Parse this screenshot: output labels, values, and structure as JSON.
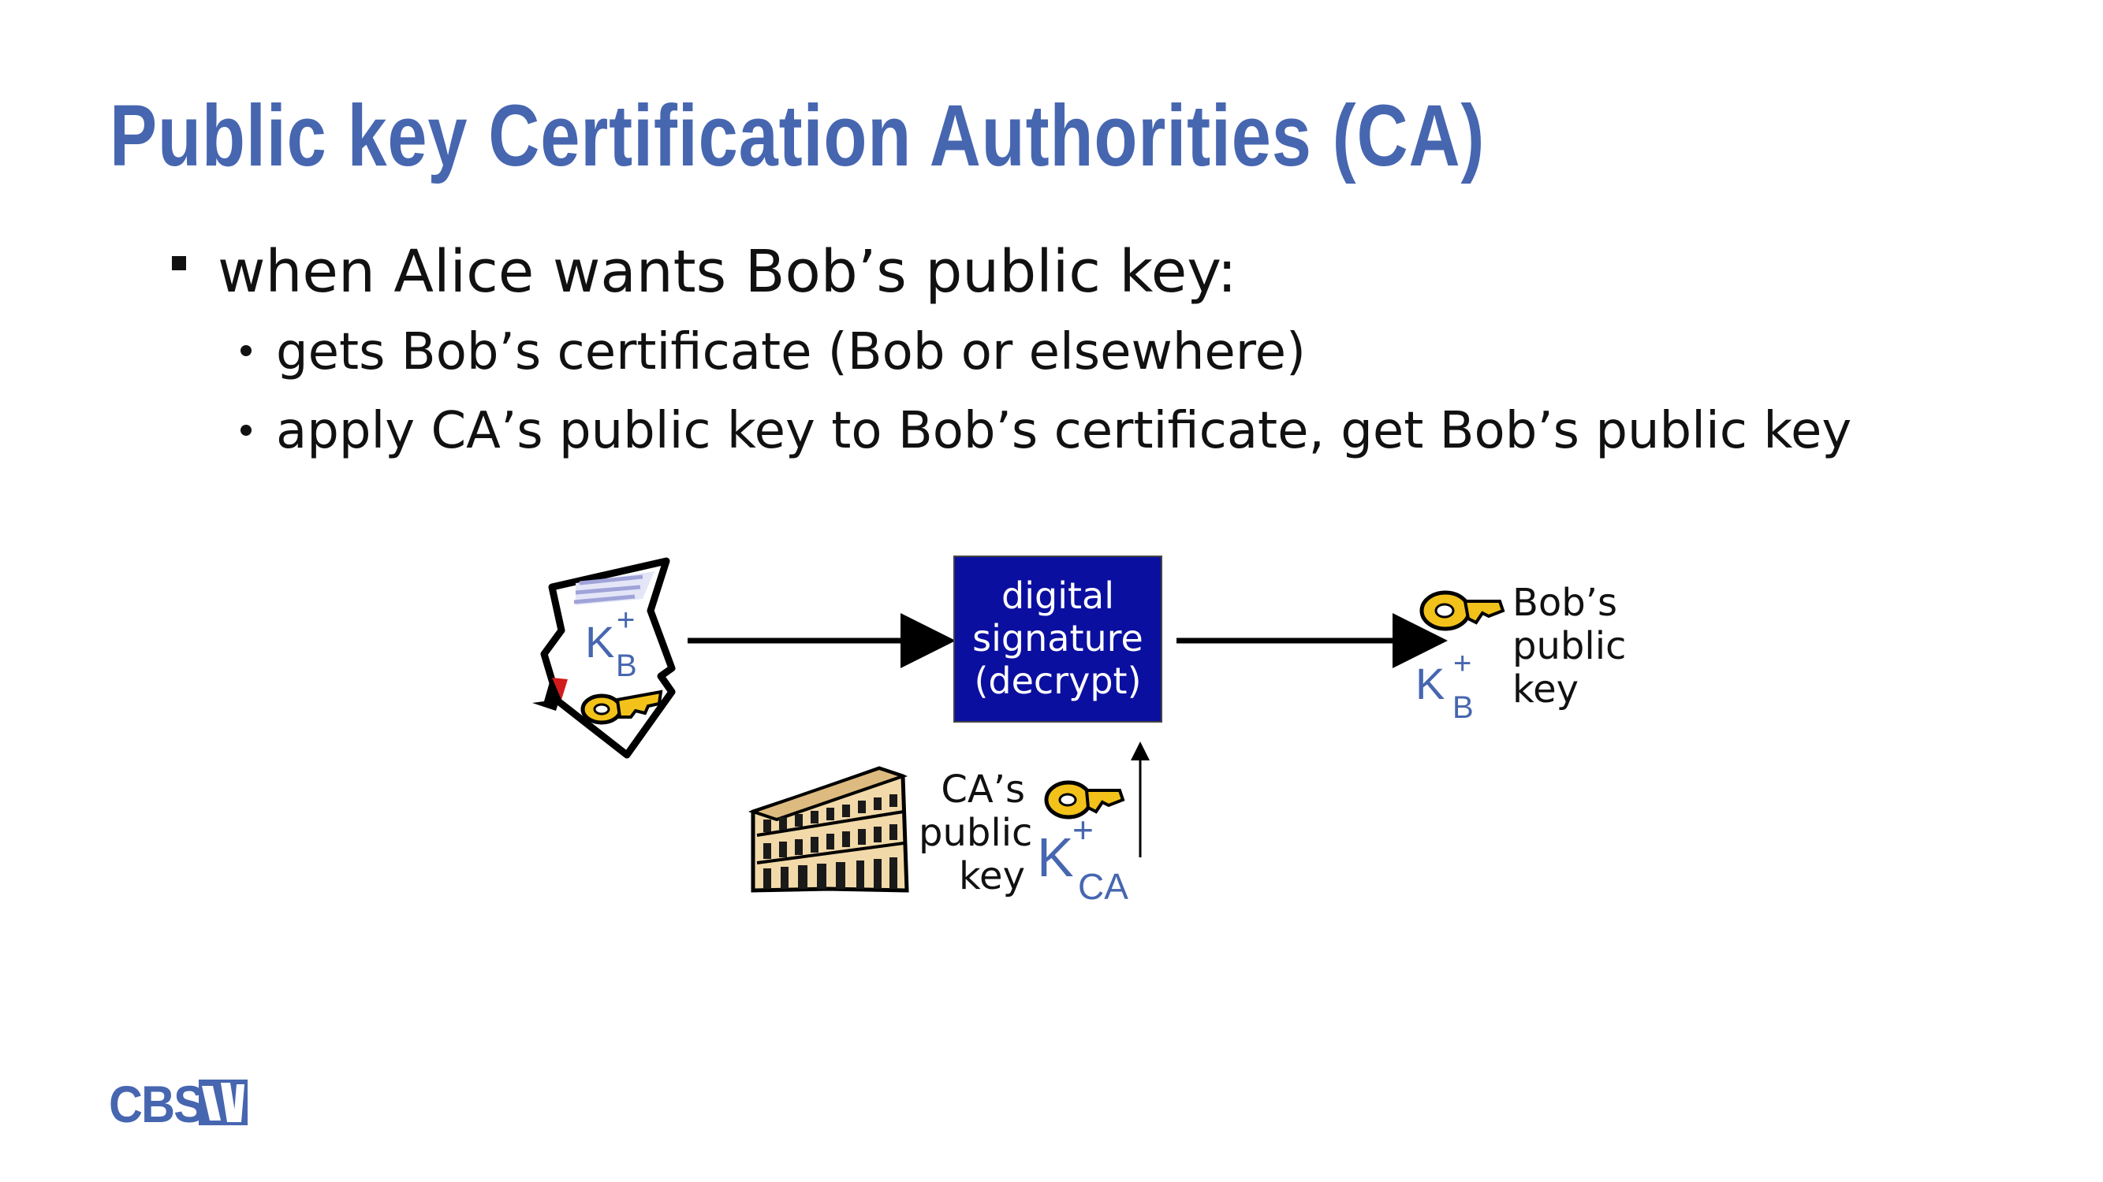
{
  "title": "Public key Certification Authorities (CA)",
  "bullets": {
    "main": "when Alice wants Bob’s public key:",
    "sub": [
      "gets Bob’s certificate (Bob or elsewhere)",
      "apply CA’s public key to Bob’s certificate, get Bob’s public key"
    ]
  },
  "diagram": {
    "certificate_key": {
      "base": "K",
      "sup": "+",
      "sub": "B"
    },
    "signature_box": [
      "digital",
      "signature",
      "(decrypt)"
    ],
    "bob_key": {
      "base": "K",
      "sup": "+",
      "sub": "B"
    },
    "bob_key_label": [
      "Bob’s",
      "public",
      "key"
    ],
    "ca_key_label": [
      "CA’s",
      "public",
      "key"
    ],
    "ca_key": {
      "base": "K",
      "sup": "+",
      "sub": "CA"
    }
  },
  "logo": "CBS",
  "colors": {
    "accent": "#4766B0",
    "box": "#0B0FA0",
    "key_gold": "#F2C21A"
  }
}
